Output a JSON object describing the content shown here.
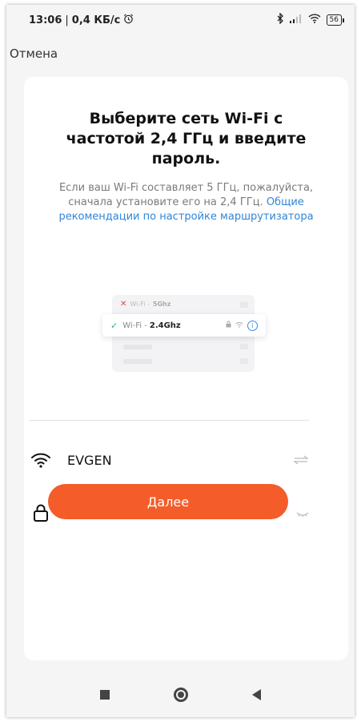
{
  "status_bar": {
    "time": "13:06",
    "separator": "|",
    "speed": "0,4 КБ/с",
    "battery": "56"
  },
  "header": {
    "cancel_label": "Отмена"
  },
  "main": {
    "title": "Выберите сеть Wi-Fi с частотой 2,4 ГГц и введите пароль.",
    "desc_text": "Если ваш Wi-Fi составляет 5 ГГц, пожалуйста, сначала установите его на 2,4 ГГц.",
    "desc_link": "Общие рекомендации по настройке маршрутизатора"
  },
  "illustration": {
    "row1_prefix": "Wi-Fi - ",
    "row1_band": "5Ghz",
    "row2_prefix": "Wi-Fi - ",
    "row2_band": "2.4Ghz",
    "info_glyph": "i"
  },
  "form": {
    "ssid_value": "EVGEN",
    "password_value": "•••••••••••••••"
  },
  "actions": {
    "next_label": "Далее"
  },
  "colors": {
    "accent": "#f45c2a",
    "link": "#2f86d6",
    "ok": "#2cb56d",
    "error": "#e04848"
  }
}
